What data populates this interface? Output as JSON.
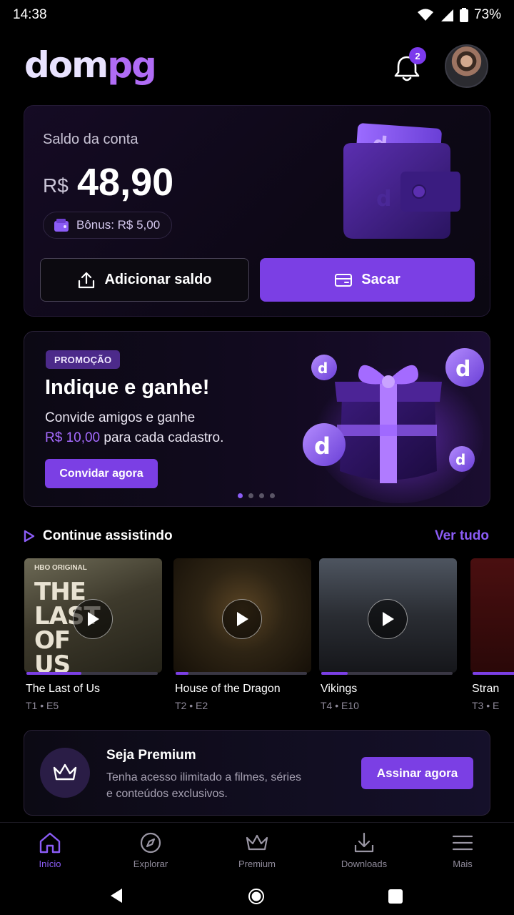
{
  "status_bar": {
    "time": "14:38",
    "battery": "73%"
  },
  "header": {
    "logo_part1": "dom",
    "logo_part2": "pg",
    "notification_count": "2"
  },
  "balance": {
    "label": "Saldo da conta",
    "currency": "R$",
    "value": "48,90",
    "bonus": "Bônus: R$ 5,00",
    "add_button": "Adicionar saldo",
    "withdraw_button": "Sacar"
  },
  "promo": {
    "tag": "PROMOÇÃO",
    "title": "Indique e ganhe!",
    "line1": "Convide amigos e ganhe",
    "amount": "R$ 10,00",
    "line2_rest": " para cada cadastro.",
    "button": "Convidar agora",
    "carousel_index": 1,
    "carousel_total": 4
  },
  "continue_watching": {
    "title": "Continue assistindo",
    "see_all": "Ver tudo",
    "items": [
      {
        "title": "The Last of Us",
        "episode": "T1 • E5",
        "progress": 0.42,
        "thumb_text_top": "HBO ORIGINAL",
        "thumb_text": "THE LAST OF US"
      },
      {
        "title": "House of the Dragon",
        "episode": "T2 • E2",
        "progress": 0.1
      },
      {
        "title": "Vikings",
        "episode": "T4 • E10",
        "progress": 0.2
      },
      {
        "title": "Stran",
        "episode": "T3 • E",
        "progress": 0.5
      }
    ]
  },
  "premium": {
    "title": "Seja Premium",
    "description": "Tenha acesso ilimitado a filmes, séries e conteúdos exclusivos.",
    "button": "Assinar agora"
  },
  "bottom_nav": {
    "items": [
      {
        "label": "Início",
        "icon": "home-icon",
        "active": true
      },
      {
        "label": "Explorar",
        "icon": "compass-icon",
        "active": false
      },
      {
        "label": "Premium",
        "icon": "crown-icon",
        "active": false
      },
      {
        "label": "Downloads",
        "icon": "download-icon",
        "active": false
      },
      {
        "label": "Mais",
        "icon": "menu-icon",
        "active": false
      }
    ]
  },
  "colors": {
    "accent": "#7b3fe4",
    "accent_text": "#8b5cf6",
    "background": "#000000"
  }
}
